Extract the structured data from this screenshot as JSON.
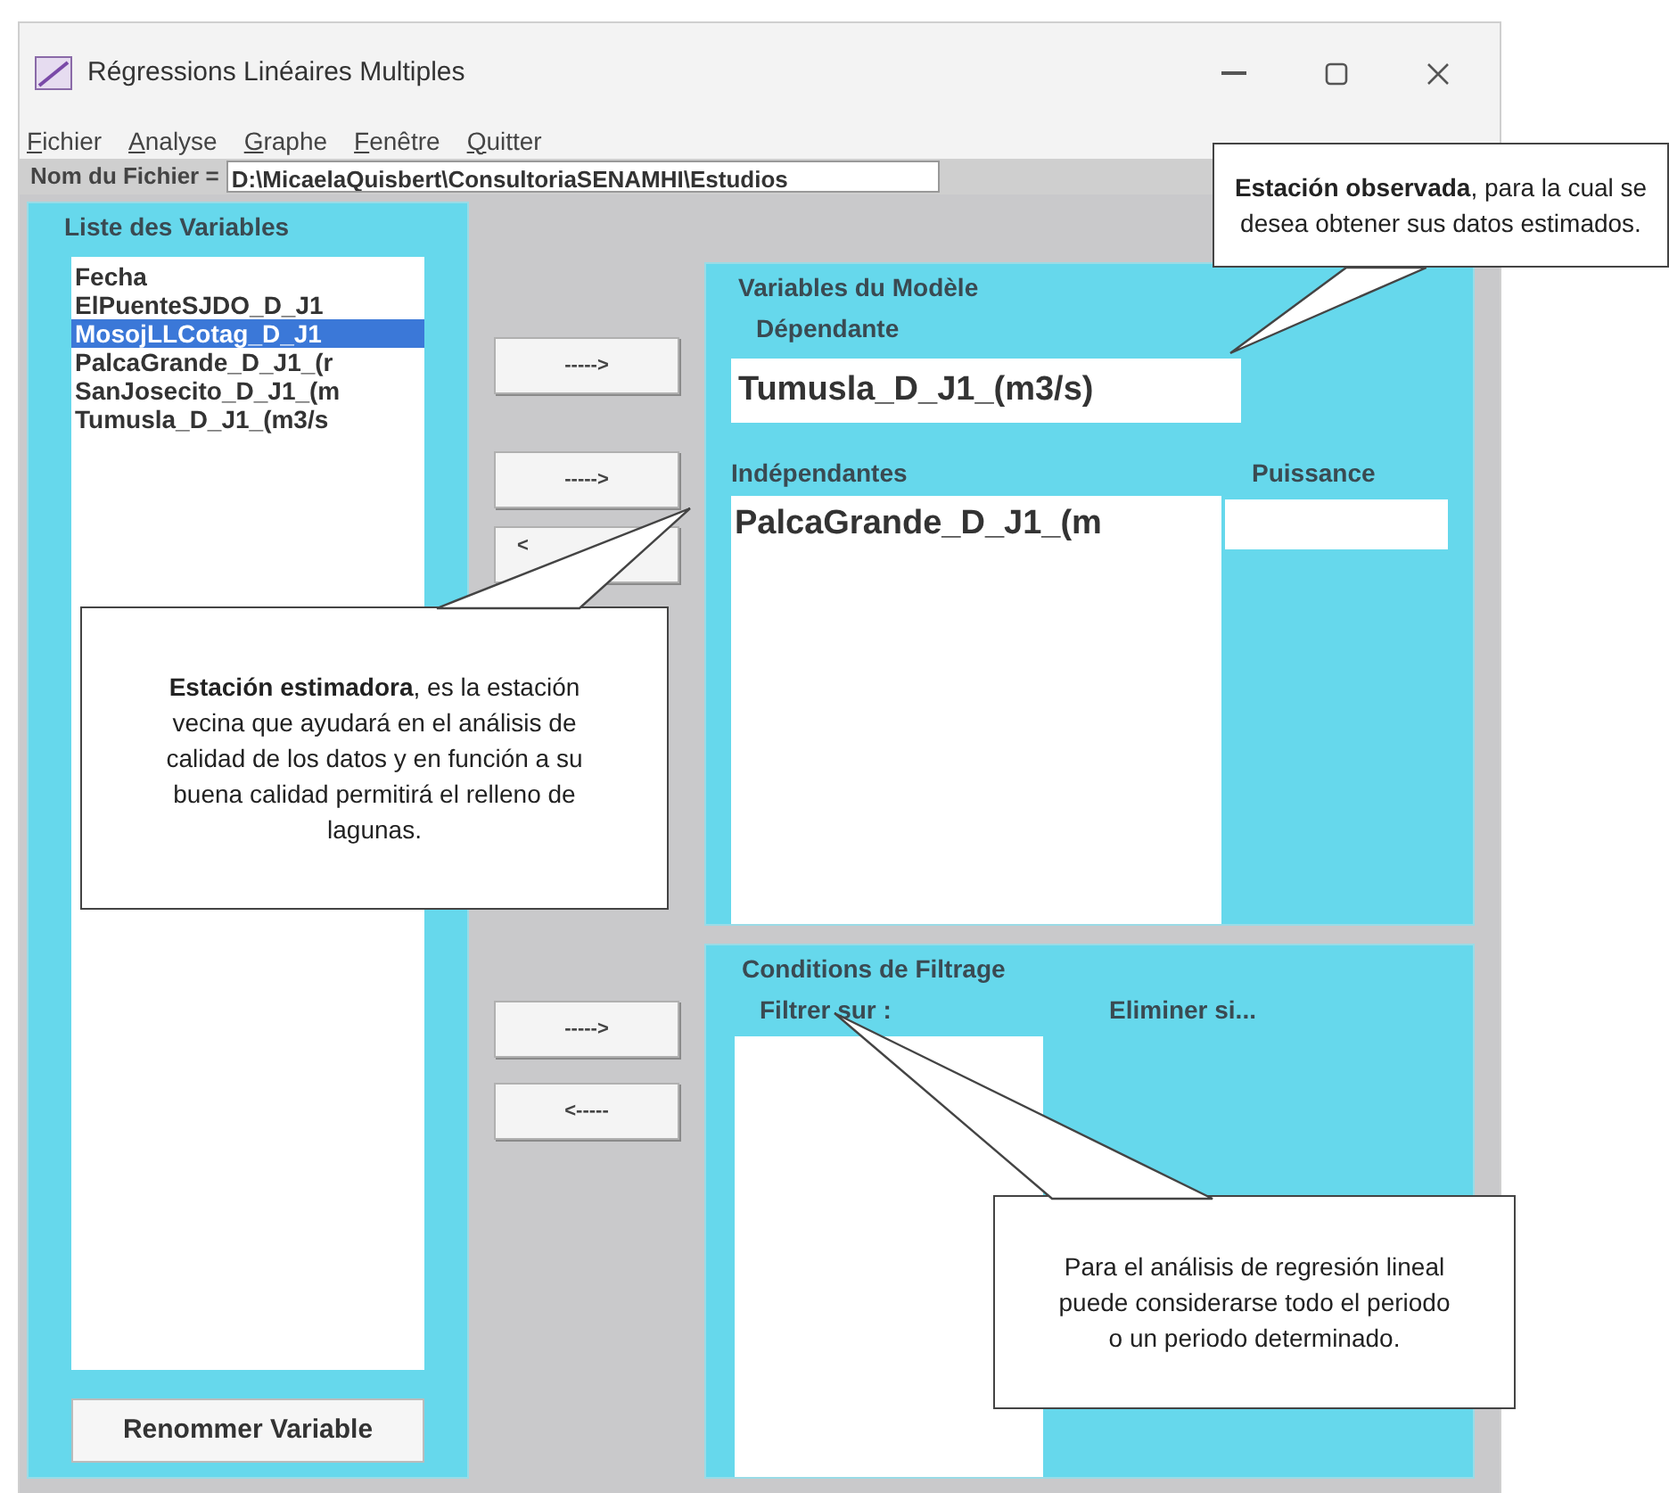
{
  "window": {
    "title": "Régressions Linéaires Multiples"
  },
  "menu": [
    {
      "label": "Fichier"
    },
    {
      "label": "Analyse"
    },
    {
      "label": "Graphe"
    },
    {
      "label": "Fenêtre"
    },
    {
      "label": "Quitter"
    }
  ],
  "file_name": {
    "label": "Nom du Fichier =",
    "value": "D:\\MicaelaQuisbert\\ConsultoriaSENAMHI\\Estudios"
  },
  "variables_panel": {
    "title": "Liste des Variables",
    "items": [
      {
        "label": "Fecha",
        "selected": false
      },
      {
        "label": "ElPuenteSJDO_D_J1",
        "selected": false
      },
      {
        "label": "MosojLLCotag_D_J1",
        "selected": true
      },
      {
        "label": "PalcaGrande_D_J1_(r",
        "selected": false
      },
      {
        "label": "SanJosecito_D_J1_(m",
        "selected": false
      },
      {
        "label": "Tumusla_D_J1_(m3/s",
        "selected": false
      }
    ],
    "rename_button": "Renommer Variable"
  },
  "model_buttons": [
    {
      "label": "----->"
    },
    {
      "label": "----->"
    },
    {
      "label": "<"
    }
  ],
  "filter_buttons": [
    {
      "label": "----->"
    },
    {
      "label": "<-----"
    }
  ],
  "model_panel": {
    "title": "Variables du Modèle",
    "dependent_label": "Dépendante",
    "dependent_value": "Tumusla_D_J1_(m3/s)",
    "independent_label": "Indépendantes",
    "power_label": "Puissance",
    "independents": [
      "PalcaGrande_D_J1_(m"
    ]
  },
  "filter_panel": {
    "title": "Conditions de Filtrage",
    "filter_label": "Filtrer sur :",
    "eliminate_label": "Eliminer si..."
  },
  "callouts": [
    {
      "text": "**Estación observada**, para la cual se desea obtener sus datos estimados."
    },
    {
      "text": "**Estación estimadora**, es la estación vecina que ayudará en el análisis de calidad de los datos y en función a su buena calidad permitirá el relleno de lagunas."
    },
    {
      "text": "Para el análisis de regresión lineal puede considerarse todo el periodo o un periodo determinado."
    }
  ]
}
